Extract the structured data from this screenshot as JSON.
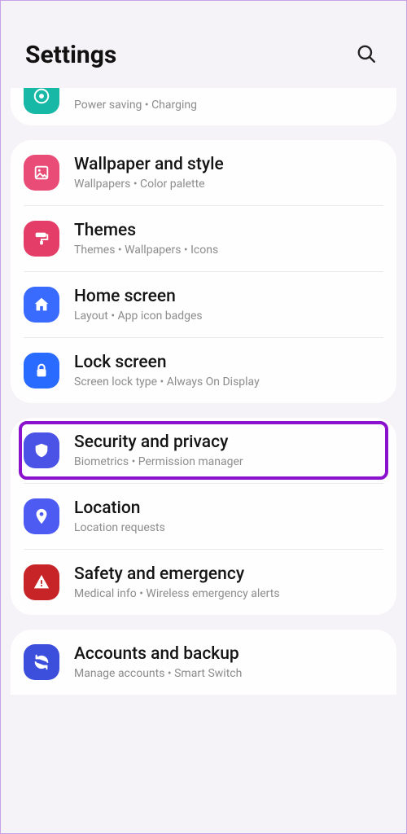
{
  "header": {
    "title": "Settings"
  },
  "groups": [
    {
      "items": [
        {
          "label": "",
          "sub": "Power saving  •  Charging",
          "icon": "battery"
        }
      ],
      "cropTop": true
    },
    {
      "items": [
        {
          "label": "Wallpaper and style",
          "sub": "Wallpapers  •  Color palette",
          "icon": "wallpaper"
        },
        {
          "label": "Themes",
          "sub": "Themes  •  Wallpapers  •  Icons",
          "icon": "themes"
        },
        {
          "label": "Home screen",
          "sub": "Layout  •  App icon badges",
          "icon": "home"
        },
        {
          "label": "Lock screen",
          "sub": "Screen lock type  •  Always On Display",
          "icon": "lock"
        }
      ]
    },
    {
      "items": [
        {
          "label": "Security and privacy",
          "sub": "Biometrics  •  Permission manager",
          "icon": "shield",
          "highlight": true
        },
        {
          "label": "Location",
          "sub": "Location requests",
          "icon": "location"
        },
        {
          "label": "Safety and emergency",
          "sub": "Medical info  •  Wireless emergency alerts",
          "icon": "alert"
        }
      ]
    },
    {
      "items": [
        {
          "label": "Accounts and backup",
          "sub": "Manage accounts  •  Smart Switch",
          "icon": "sync"
        }
      ],
      "cropBot": true
    }
  ]
}
